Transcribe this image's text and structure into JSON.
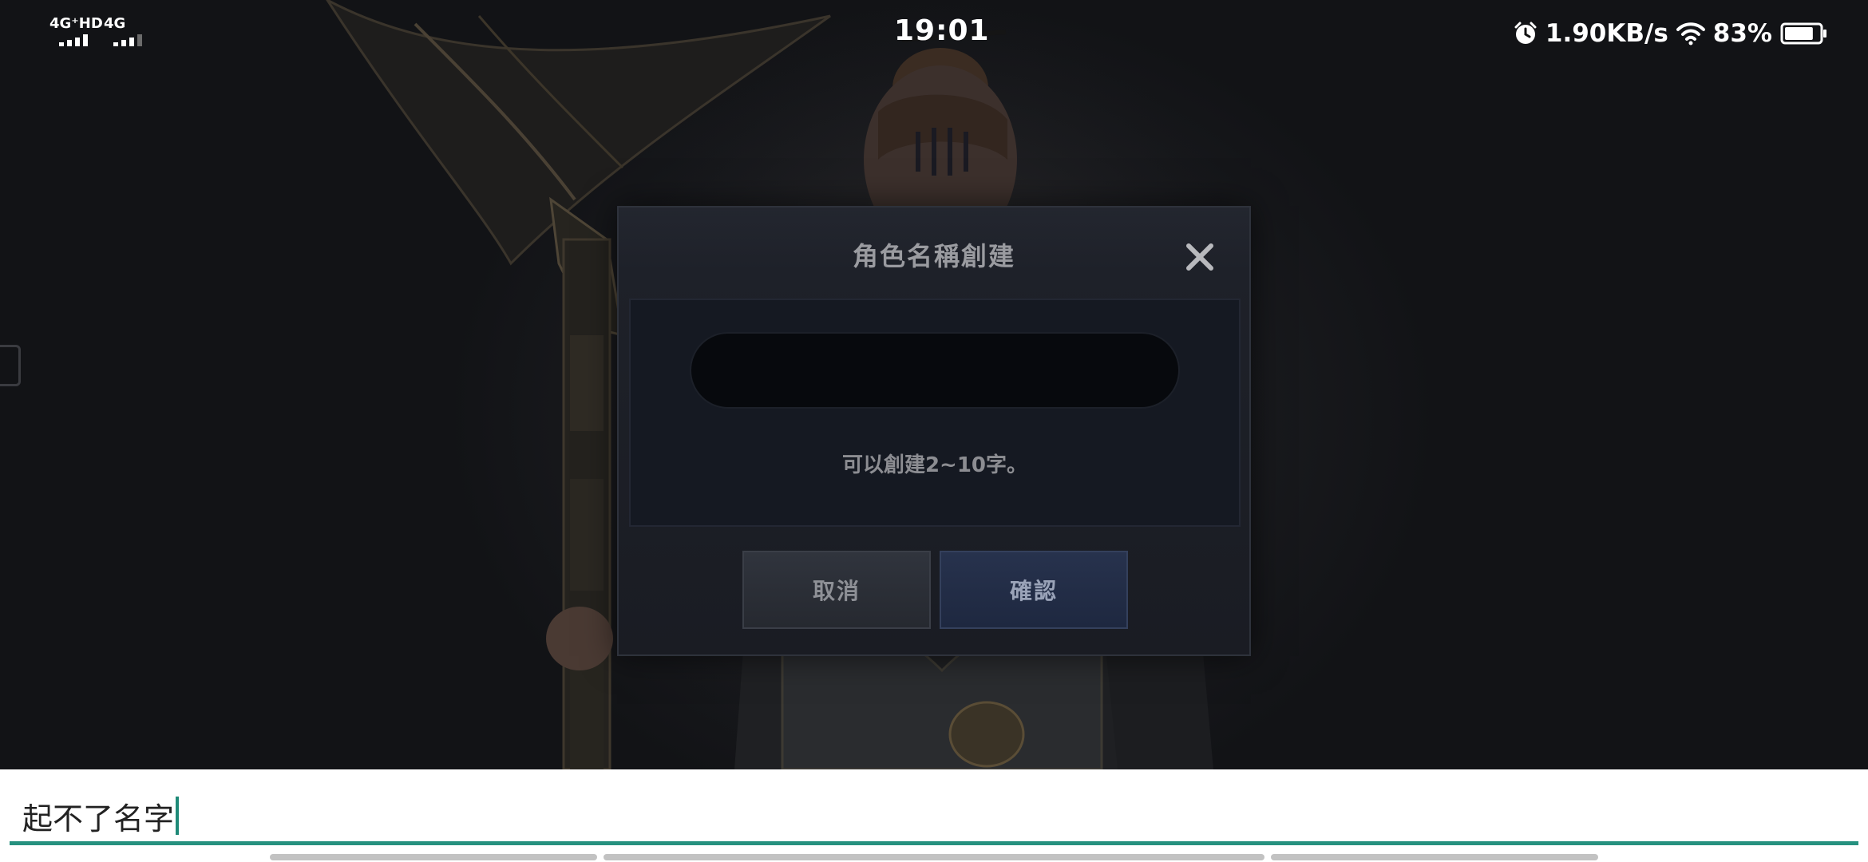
{
  "status_bar": {
    "sim1_label": "4G⁺HD",
    "sim2_label": "4G",
    "time": "19:01",
    "net_speed": "1.90KB/s",
    "battery": "83%",
    "battery_level": 0.83,
    "icons": [
      "signal-icon",
      "alarm-icon",
      "wifi-icon",
      "battery-icon"
    ]
  },
  "dialog": {
    "title": "角色名稱創建",
    "close_icon": "close-icon",
    "name_input": {
      "value": "",
      "placeholder": ""
    },
    "hint": "可以創建2~10字。",
    "cancel_label": "取消",
    "confirm_label": "確認"
  },
  "ime": {
    "text": "起不了名字"
  },
  "colors": {
    "accent": "#26917f",
    "dialog_bg": "#1e2129",
    "confirm_bg": "#27324d",
    "cancel_bg": "#30343d"
  }
}
